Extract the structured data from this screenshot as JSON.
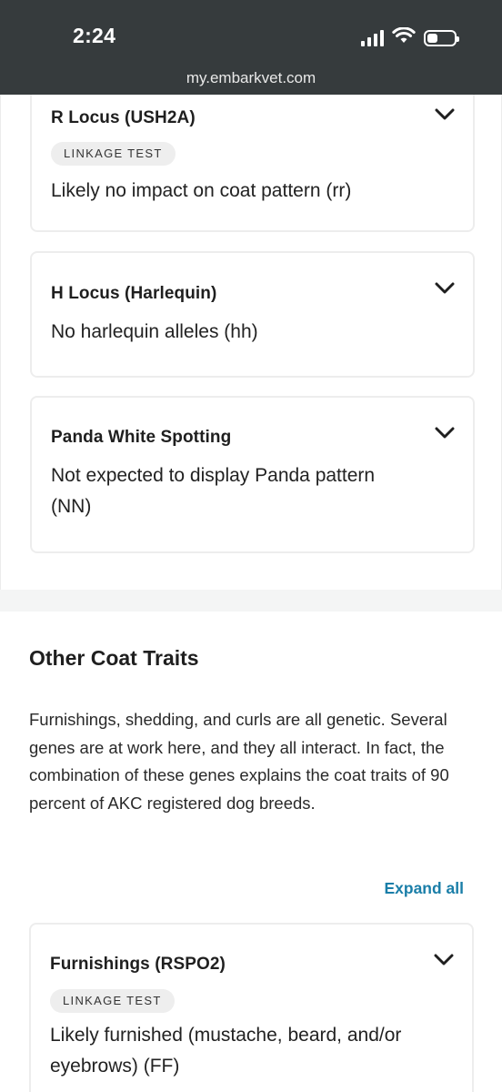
{
  "status_bar": {
    "time": "2:24",
    "battery_level": 0.4
  },
  "browser": {
    "url": "my.embarkvet.com"
  },
  "coat_pattern_cards": [
    {
      "title": "R Locus (USH2A)",
      "badge": "LINKAGE TEST",
      "result": "Likely no impact on coat pattern (rr)"
    },
    {
      "title": "H Locus (Harlequin)",
      "result": "No harlequin alleles (hh)"
    },
    {
      "title": "Panda White Spotting",
      "result": "Not expected to display Panda pattern (NN)"
    }
  ],
  "other_coat_traits": {
    "title": "Other Coat Traits",
    "description": "Furnishings, shedding, and curls are all genetic. Several genes are at work here, and they all interact. In fact, the combination of these genes explains the coat traits of 90 percent of AKC registered dog breeds.",
    "expand_all_label": "Expand all",
    "cards": [
      {
        "title": "Furnishings (RSPO2)",
        "badge": "LINKAGE TEST",
        "result": "Likely furnished (mustache, beard, and/or eyebrows) (FF)"
      }
    ]
  },
  "icons": {
    "expand": "chevron-down-icon"
  },
  "colors": {
    "link": "#1a7ea8",
    "topbar": "#363b3d",
    "badge_bg": "#eeeeee"
  }
}
